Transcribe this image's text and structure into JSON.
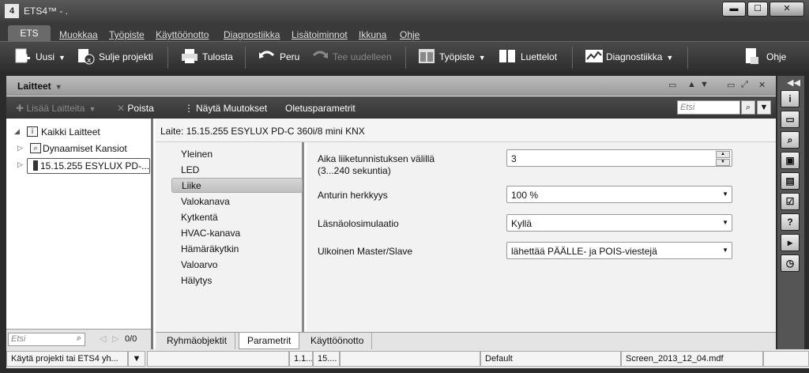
{
  "window": {
    "title": "ETS4™ - .",
    "app_icon": "4",
    "minimize": "▬",
    "maximize": "☐",
    "close": "✕"
  },
  "menu": {
    "ets_tab": "ETS",
    "items": [
      "Muokkaa",
      "Työpiste",
      "Käyttöönotto",
      "Diagnostiikka",
      "Lisätoiminnot",
      "Ikkuna",
      "Ohje"
    ]
  },
  "toolbar": {
    "new": "Uusi",
    "close_project": "Sulje projekti",
    "print": "Tulosta",
    "undo": "Peru",
    "redo": "Tee uudelleen",
    "workspace": "Työpiste",
    "catalogs": "Luettelot",
    "diagnostics": "Diagnostiikka",
    "help": "Ohje"
  },
  "devices_panel": {
    "title": "Laitteet",
    "add_devices": "Lisää Laitteita",
    "delete": "Poista",
    "show_changes": "Näytä Muutokset",
    "default_params": "Oletusparametrit",
    "search_placeholder": "Etsi"
  },
  "tree": {
    "all_devices": "Kaikki Laitteet",
    "dynamic_folders": "Dynaamiset Kansiot",
    "device": "15.15.255  ESYLUX PD-...",
    "search_placeholder": "Etsi",
    "count": "0/0"
  },
  "detail": {
    "device_header": "Laite: 15.15.255  ESYLUX PD-C 360i/8 mini KNX",
    "nav": [
      "Yleinen",
      "LED",
      "Liike",
      "Valokanava",
      "Kytkentä",
      "HVAC-kanava",
      "Hämäräkytkin",
      "Valoarvo",
      "Hälytys"
    ],
    "selected_nav": "Liike",
    "params": [
      {
        "label": "Aika liiketunnistuksen välillä",
        "sublabel": "(3...240 sekuntia)",
        "value": "3"
      },
      {
        "label": "Anturin herkkyys",
        "value": "100 %"
      },
      {
        "label": "Läsnäolosimulaatio",
        "value": "Kyllä"
      },
      {
        "label": "Ulkoinen Master/Slave",
        "value": "lähettää PÄÄLLE- ja POIS-viestejä"
      }
    ],
    "tabs": [
      "Ryhmäobjektit",
      "Parametrit",
      "Käyttöönotto"
    ],
    "active_tab": "Parametrit"
  },
  "status": {
    "action": "Käytä projekti tai ETS4 yh...",
    "c1": "1.1...",
    "c2": "15....",
    "mode": "Default",
    "file": "Screen_2013_12_04.mdf"
  },
  "sidebar_icons": [
    "info-icon",
    "folder-icon",
    "search-icon",
    "window-icon",
    "book-icon",
    "checklist-icon",
    "help-icon",
    "forward-icon",
    "clock-icon"
  ]
}
